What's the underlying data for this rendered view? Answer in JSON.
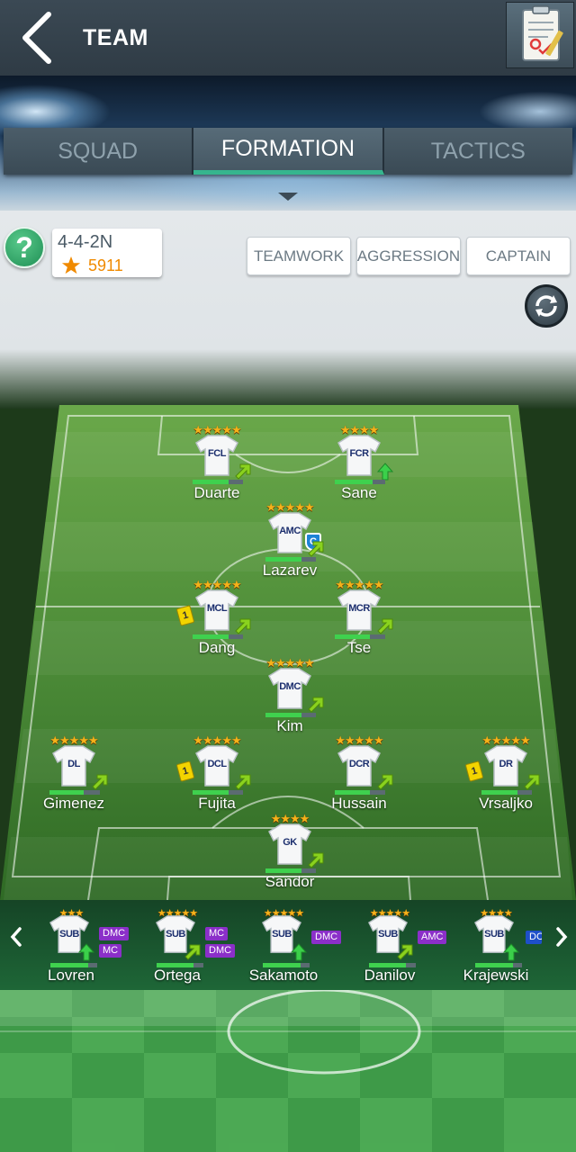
{
  "header": {
    "title": "TEAM"
  },
  "tabs": [
    {
      "label": "SQUAD",
      "active": false
    },
    {
      "label": "FORMATION",
      "active": true
    },
    {
      "label": "TACTICS",
      "active": false
    }
  ],
  "formation": {
    "name": "4-4-2N",
    "rating": "5911"
  },
  "help": {
    "label": "?"
  },
  "options": {
    "teamwork": "TEAMWORK",
    "aggression": "AGGRESSION",
    "captain": "CAPTAIN"
  },
  "players": [
    {
      "name": "Duarte",
      "pos": "FCL",
      "stars": "★★★★★",
      "fitness": 0.72,
      "arrow": "diagonal"
    },
    {
      "name": "Sane",
      "pos": "FCR",
      "stars": "★★★★",
      "fitness": 0.75,
      "arrow": "up"
    },
    {
      "name": "Lazarev",
      "pos": "AMC",
      "stars": "★★★★★",
      "fitness": 0.72,
      "arrow": "diagonal",
      "captain": "C"
    },
    {
      "name": "Dang",
      "pos": "MCL",
      "stars": "★★★★★",
      "fitness": 0.72,
      "arrow": "diagonal",
      "card": "1"
    },
    {
      "name": "Tse",
      "pos": "MCR",
      "stars": "★★★★★",
      "fitness": 0.7,
      "arrow": "diagonal"
    },
    {
      "name": "Kim",
      "pos": "DMC",
      "stars": "★★★★★",
      "fitness": 0.72,
      "arrow": "diagonal"
    },
    {
      "name": "Gimenez",
      "pos": "DL",
      "stars": "★★★★★",
      "fitness": 0.68,
      "arrow": "diagonal"
    },
    {
      "name": "Fujita",
      "pos": "DCL",
      "stars": "★★★★★",
      "fitness": 0.72,
      "arrow": "diagonal",
      "card": "1"
    },
    {
      "name": "Hussain",
      "pos": "DCR",
      "stars": "★★★★★",
      "fitness": 0.7,
      "arrow": "diagonal"
    },
    {
      "name": "Vrsaljko",
      "pos": "DR",
      "stars": "★★★★★",
      "fitness": 0.72,
      "arrow": "diagonal",
      "card": "1"
    },
    {
      "name": "Sandor",
      "pos": "GK",
      "stars": "★★★★",
      "fitness": 0.72,
      "arrow": "diagonal"
    }
  ],
  "subs": [
    {
      "name": "Lovren",
      "pos": "SUB",
      "stars": "★★★",
      "fitness": 0.8,
      "arrow": "up",
      "roles": [
        "DMC",
        "MC"
      ]
    },
    {
      "name": "Ortega",
      "pos": "SUB",
      "stars": "★★★★★",
      "fitness": 0.78,
      "arrow": "diagonal",
      "roles": [
        "MC",
        "DMC"
      ]
    },
    {
      "name": "Sakamoto",
      "pos": "SUB",
      "stars": "★★★★★",
      "fitness": 0.8,
      "arrow": "up",
      "roles": [
        "DMC"
      ]
    },
    {
      "name": "Danilov",
      "pos": "SUB",
      "stars": "★★★★★",
      "fitness": 0.78,
      "arrow": "diagonal",
      "roles": [
        "AMC"
      ]
    },
    {
      "name": "Krajewski",
      "pos": "SUB",
      "stars": "★★★★",
      "fitness": 0.8,
      "arrow": "up",
      "roles": [
        "DC"
      ]
    }
  ],
  "colors": {
    "accent": "#36b58e",
    "star": "#f5b21a",
    "rating": "#f08a00",
    "role_tag": "#8b2fc9",
    "role_tag_alt": "#1e4fc9"
  },
  "icons": {
    "back": "back-chevron-icon",
    "notes": "clipboard-icon",
    "refresh": "refresh-icon",
    "star": "star-icon"
  }
}
